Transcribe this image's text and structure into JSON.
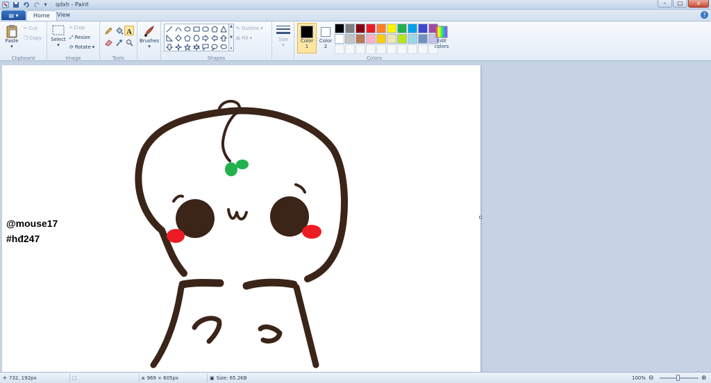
{
  "window": {
    "title": "qdxh - Paint",
    "minimize": "–",
    "maximize": "□",
    "close": "x",
    "help": "?"
  },
  "tabs": {
    "file": "▤ ▾",
    "home": "Home",
    "view": "View"
  },
  "ribbon": {
    "clipboard": {
      "label": "Clipboard",
      "paste": "Paste",
      "cut": "Cut",
      "copy": "Copy"
    },
    "image": {
      "label": "Image",
      "select": "Select",
      "crop": "Crop",
      "resize": "Resize",
      "rotate": "Rotate"
    },
    "tools": {
      "label": "Tools"
    },
    "brushes": {
      "label": "Brushes"
    },
    "shapes": {
      "label": "Shapes",
      "outline": "Outline",
      "fill": "Fill"
    },
    "size": {
      "label": "Size"
    },
    "colors": {
      "label": "Colors",
      "color1": "Color",
      "color1_num": "1",
      "color2": "Color",
      "color2_num": "2",
      "edit": "Edit",
      "edit2": "colors",
      "color1_value": "#000000",
      "color2_value": "#ffffff",
      "palette": [
        "#000000",
        "#7f7f7f",
        "#880015",
        "#ed1c24",
        "#ff7f27",
        "#fff200",
        "#22b14c",
        "#00a2e8",
        "#3f48cc",
        "#a349a4",
        "#ffffff",
        "#c3c3c3",
        "#b97a57",
        "#ffaec9",
        "#ffc90e",
        "#efe4b0",
        "#b5e61d",
        "#99d9ea",
        "#7092be",
        "#c8bfe7"
      ],
      "empty_slots": 10
    }
  },
  "canvas": {
    "text_line1": "@mouse17",
    "text_line2": "#hđ247",
    "stroke_color": "#3b2418",
    "green": "#22b14c",
    "red": "#ed1c24"
  },
  "status": {
    "cursor": "732, 192px",
    "dimensions": "969 × 605px",
    "size": "Size: 65.2KB",
    "zoom": "100%",
    "zoom_out": "⊖",
    "zoom_in": "⊕"
  }
}
